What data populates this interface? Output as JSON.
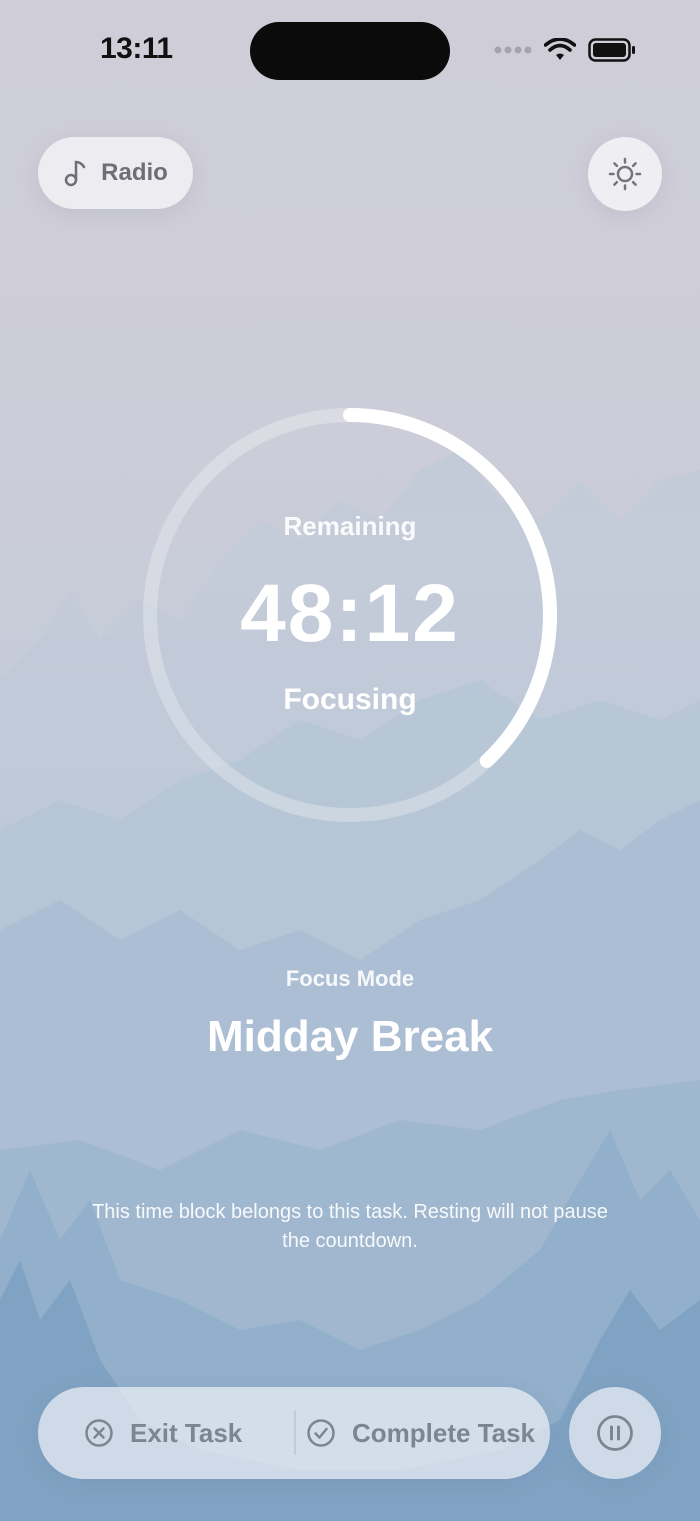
{
  "status_bar": {
    "time": "13:11"
  },
  "header": {
    "radio_label": "Radio",
    "radio_icon": "music-note-icon",
    "theme_icon": "sun-icon"
  },
  "timer": {
    "remaining_label": "Remaining",
    "time": "48:12",
    "state": "Focusing",
    "progress": 0.38
  },
  "mode": {
    "label": "Focus Mode",
    "title": "Midday Break"
  },
  "note": "This time block belongs to this task. Resting will not pause the countdown.",
  "actions": {
    "exit_label": "Exit Task",
    "complete_label": "Complete Task",
    "pause_icon": "pause-icon"
  }
}
